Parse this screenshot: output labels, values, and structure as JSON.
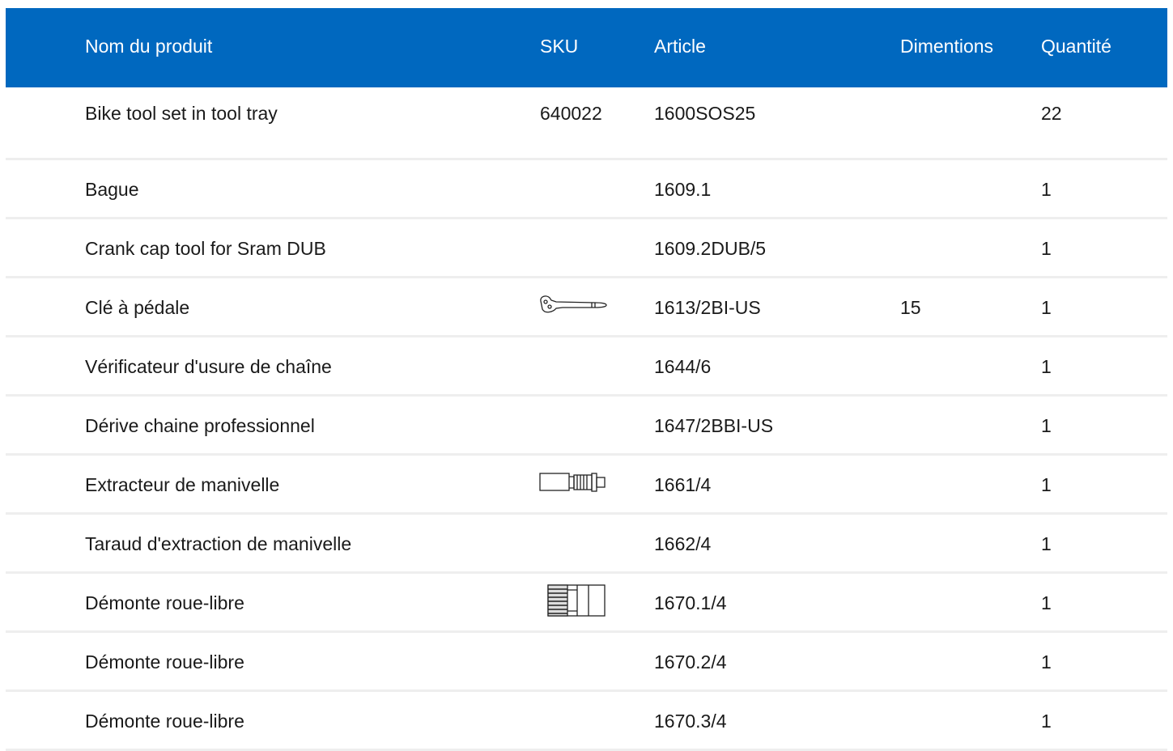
{
  "headers": {
    "name": "Nom du produit",
    "sku": "SKU",
    "article": "Article",
    "dimensions": "Dimentions",
    "quantity": "Quantité"
  },
  "rows": [
    {
      "name": "Bike tool set in tool tray",
      "sku": "640022",
      "article": "1600SOS25",
      "dimensions": "",
      "quantity": "22",
      "icon": ""
    },
    {
      "name": "Bague",
      "sku": "",
      "article": "1609.1",
      "dimensions": "",
      "quantity": "1",
      "icon": ""
    },
    {
      "name": "Crank cap tool for Sram DUB",
      "sku": "",
      "article": "1609.2DUB/5",
      "dimensions": "",
      "quantity": "1",
      "icon": ""
    },
    {
      "name": "Clé à pédale",
      "sku": "",
      "article": "1613/2BI-US",
      "dimensions": "15",
      "quantity": "1",
      "icon": "pedal-wrench-icon"
    },
    {
      "name": "Vérificateur d'usure de chaîne",
      "sku": "",
      "article": "1644/6",
      "dimensions": "",
      "quantity": "1",
      "icon": ""
    },
    {
      "name": "Dérive chaine professionnel",
      "sku": "",
      "article": "1647/2BBI-US",
      "dimensions": "",
      "quantity": "1",
      "icon": ""
    },
    {
      "name": "Extracteur de manivelle",
      "sku": "",
      "article": "1661/4",
      "dimensions": "",
      "quantity": "1",
      "icon": "crank-puller-icon"
    },
    {
      "name": "Taraud d'extraction de manivelle",
      "sku": "",
      "article": "1662/4",
      "dimensions": "",
      "quantity": "1",
      "icon": ""
    },
    {
      "name": "Démonte roue-libre",
      "sku": "",
      "article": "1670.1/4",
      "dimensions": "",
      "quantity": "1",
      "icon": "freewheel-remover-icon"
    },
    {
      "name": "Démonte roue-libre",
      "sku": "",
      "article": "1670.2/4",
      "dimensions": "",
      "quantity": "1",
      "icon": ""
    },
    {
      "name": "Démonte roue-libre",
      "sku": "",
      "article": "1670.3/4",
      "dimensions": "",
      "quantity": "1",
      "icon": ""
    }
  ],
  "colors": {
    "header_bg": "#0068bf",
    "header_text": "#ffffff",
    "row_divider": "#eeeeee"
  }
}
